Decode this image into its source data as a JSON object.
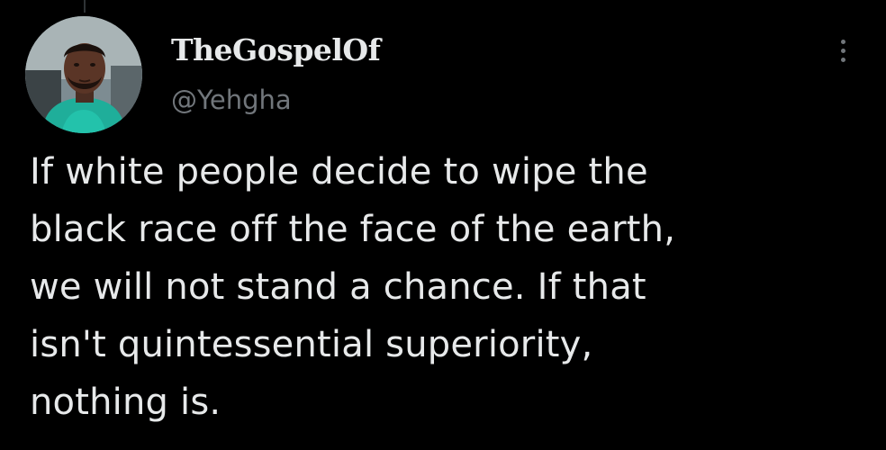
{
  "colors": {
    "background": "#000000",
    "primary_text": "#e7e9ea",
    "secondary_text": "#71767b"
  },
  "author": {
    "display_name": "TheGospelOf",
    "handle": "@Yehgha",
    "avatar_icon": "profile-photo"
  },
  "menu": {
    "icon": "more-options-icon"
  },
  "tweet": {
    "lines": [
      "If white people decide to wipe the",
      "black race off the face of the earth,",
      "we will not stand a chance. If that",
      "isn't quintessential superiority,",
      "nothing is."
    ]
  }
}
